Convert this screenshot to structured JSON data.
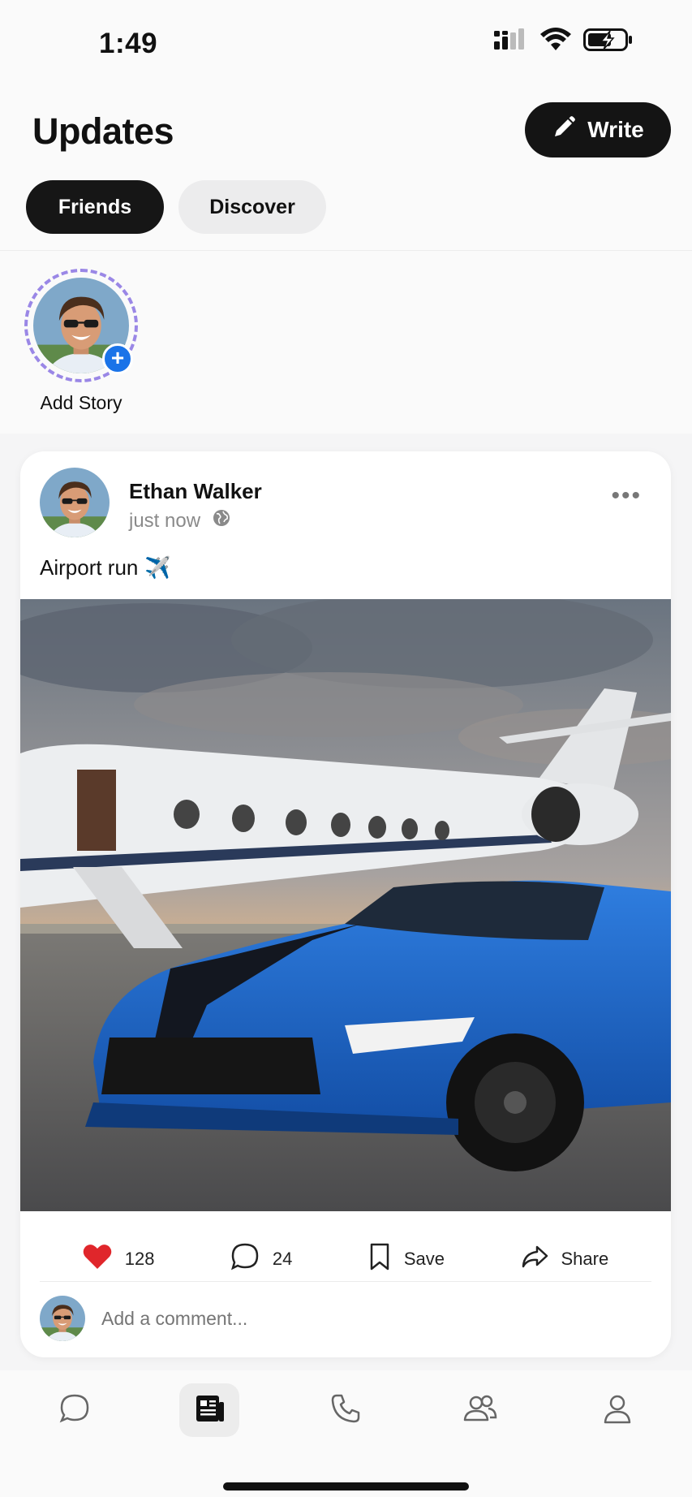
{
  "status_bar": {
    "time": "1:49"
  },
  "header": {
    "title": "Updates",
    "write_label": "Write",
    "tabs": [
      {
        "label": "Friends",
        "active": true
      },
      {
        "label": "Discover",
        "active": false
      }
    ]
  },
  "stories": {
    "items": [
      {
        "label": "Add Story"
      }
    ]
  },
  "post": {
    "author": "Ethan Walker",
    "time": "just now",
    "text": "Airport run",
    "text_emoji": "✈️",
    "likes": "128",
    "comments": "24",
    "save_label": "Save",
    "share_label": "Share",
    "comment_placeholder": "Add a comment..."
  },
  "bottom_nav": {
    "items": [
      {
        "icon": "chat-bubble-icon",
        "active": false
      },
      {
        "icon": "newspaper-icon",
        "active": true
      },
      {
        "icon": "phone-icon",
        "active": false
      },
      {
        "icon": "people-icon",
        "active": false
      },
      {
        "icon": "person-icon",
        "active": false
      }
    ]
  },
  "colors": {
    "accent_blue": "#1a73e8",
    "story_ring": "#9a87e6",
    "heart_red": "#e0262b",
    "dark": "#141414"
  }
}
